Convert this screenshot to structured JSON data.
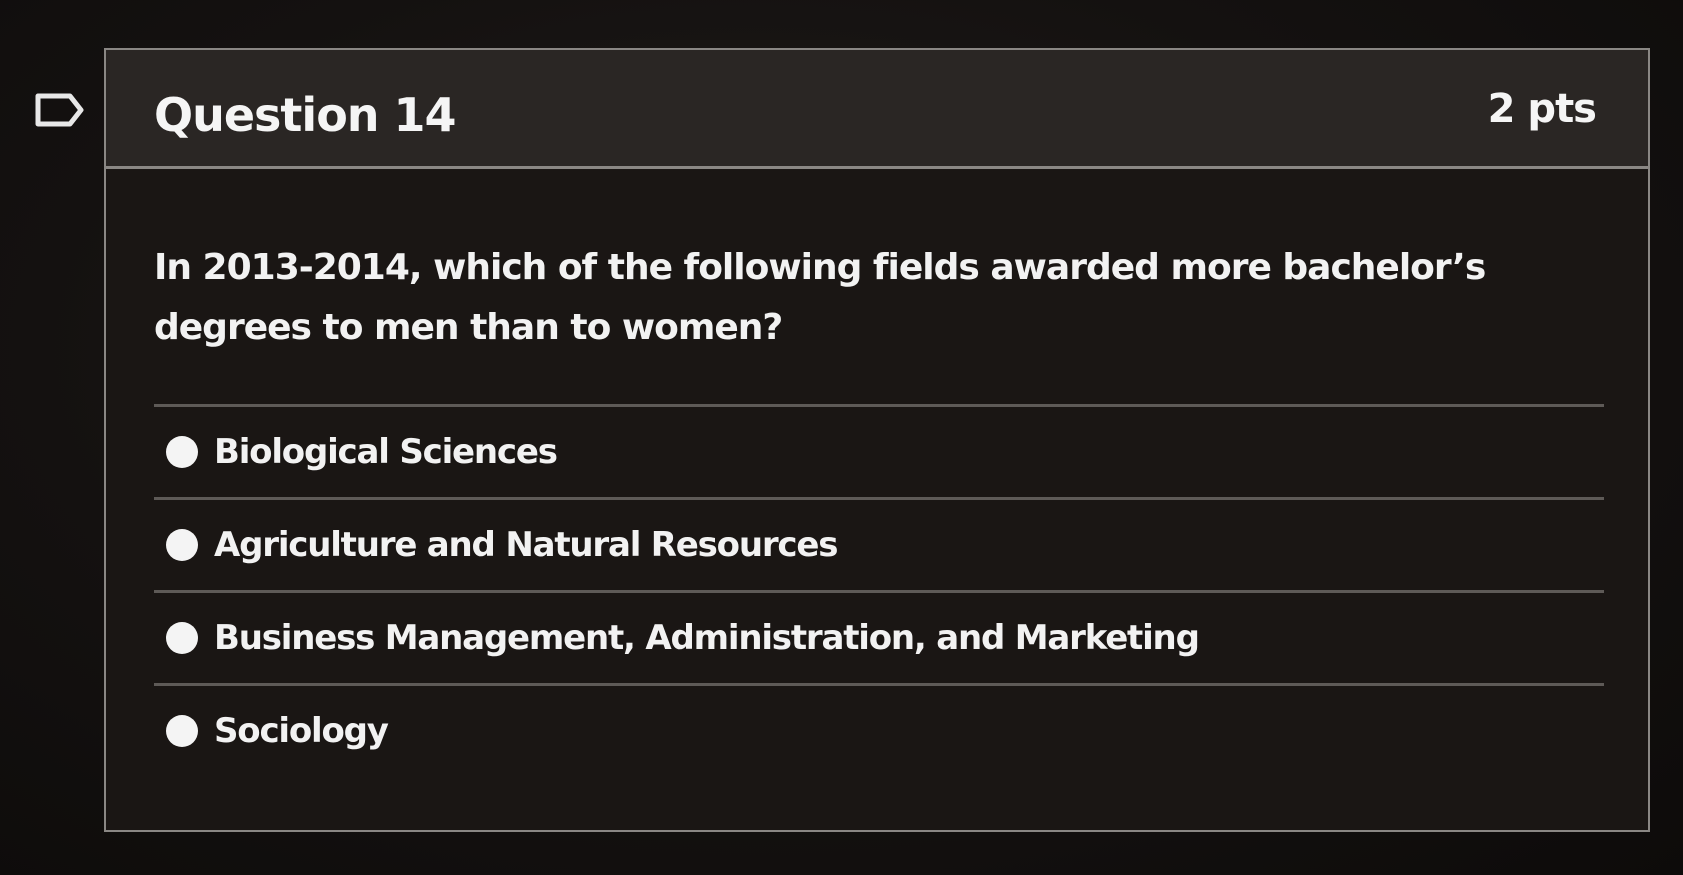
{
  "question": {
    "title": "Question 14",
    "points": "2 pts",
    "text": "In 2013-2014, which of the following fields awarded more bachelor’s degrees to men than to women?"
  },
  "answers": [
    {
      "label": "Biological Sciences"
    },
    {
      "label": "Agriculture and Natural Resources"
    },
    {
      "label": "Business Management, Administration, and Marketing"
    },
    {
      "label": "Sociology"
    }
  ],
  "icons": {
    "flag": "bookmark-flag-icon"
  },
  "colors": {
    "background": "#141110",
    "header": "#2a2624",
    "border": "#8a8784",
    "text": "#f2f2f2"
  }
}
